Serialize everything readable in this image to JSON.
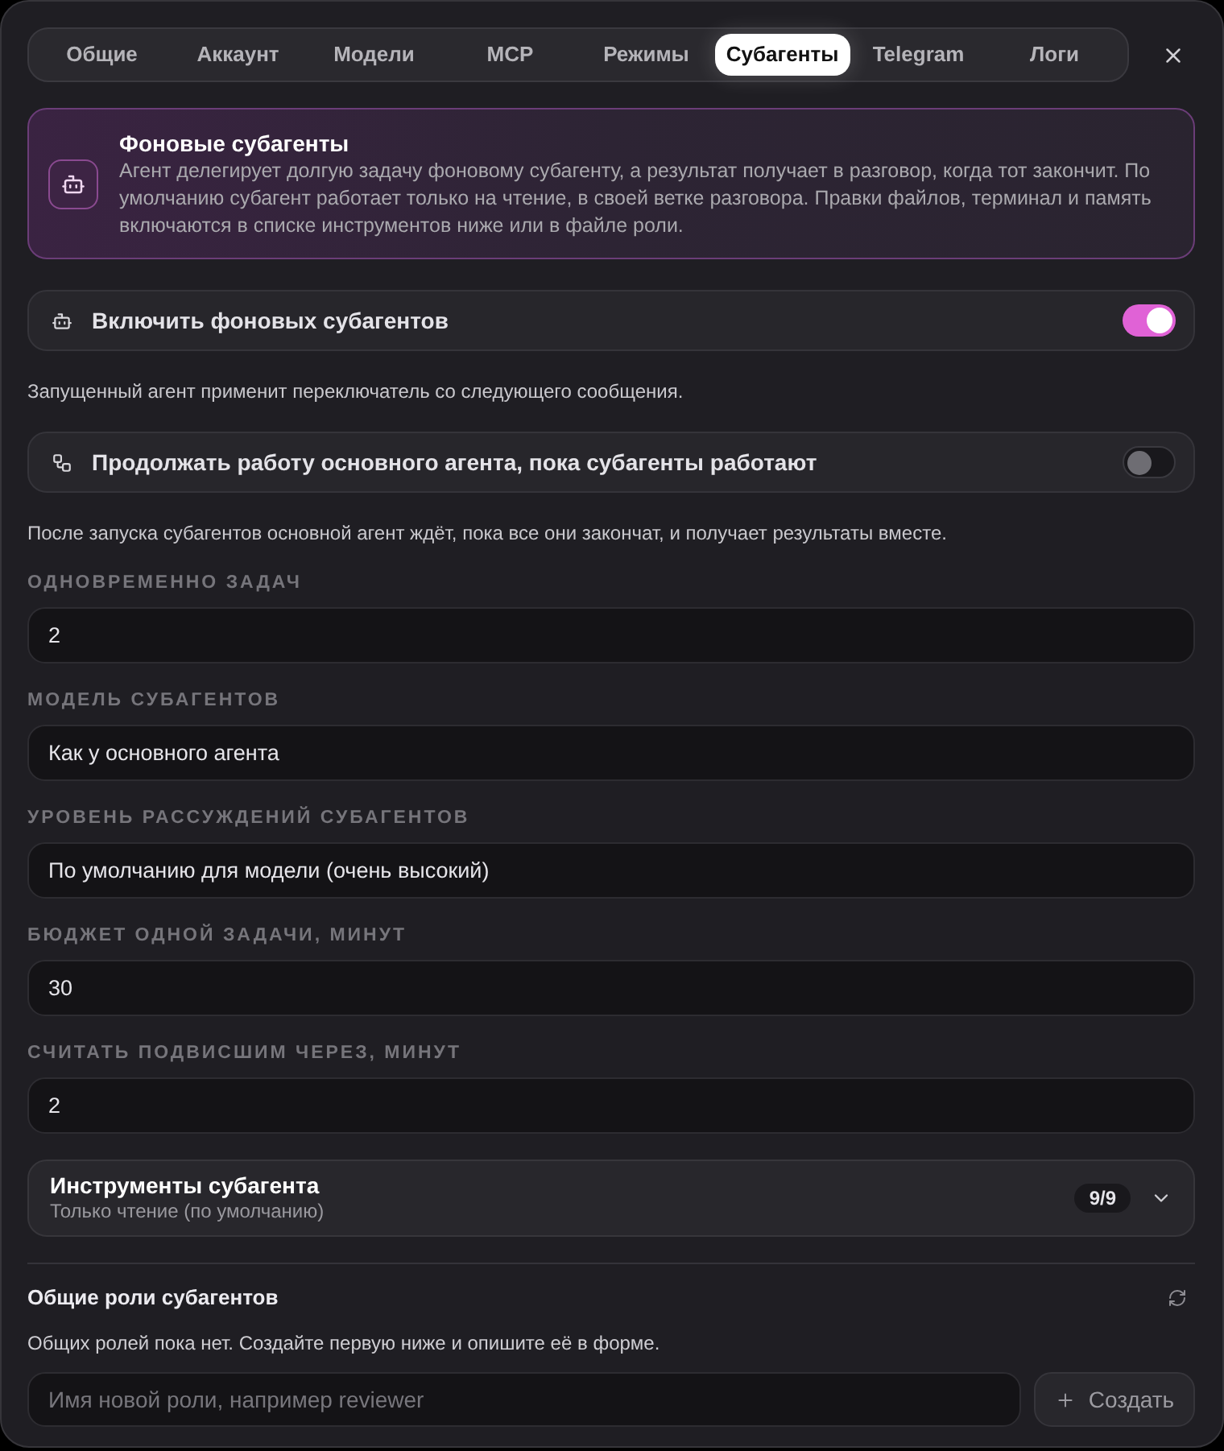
{
  "tabs": [
    {
      "label": "Общие",
      "selected": false
    },
    {
      "label": "Аккаунт",
      "selected": false
    },
    {
      "label": "Модели",
      "selected": false
    },
    {
      "label": "MCP",
      "selected": false
    },
    {
      "label": "Режимы",
      "selected": false
    },
    {
      "label": "Субагенты",
      "selected": true
    },
    {
      "label": "Telegram",
      "selected": false
    },
    {
      "label": "Логи",
      "selected": false
    }
  ],
  "info_card": {
    "title": "Фоновые субагенты",
    "text": "Агент делегирует долгую задачу фоновому субагенту, а результат получает в разговор, когда тот закончит. По умолчанию субагент работает только на чтение, в своей ветке разговора. Правки файлов, терминал и память включаются в списке инструментов ниже или в файле роли."
  },
  "toggles": [
    {
      "label": "Включить фоновых субагентов",
      "on": true,
      "note": "Запущенный агент применит переключатель со следующего сообщения."
    },
    {
      "label": "Продолжать работу основного агента, пока субагенты работают",
      "on": false,
      "note": "После запуска субагентов основной агент ждёт, пока все они закончат, и получает результаты вместе."
    }
  ],
  "fields": [
    {
      "label": "ОДНОВРЕМЕННО ЗАДАЧ",
      "value": "2"
    },
    {
      "label": "МОДЕЛЬ СУБАГЕНТОВ",
      "value": "Как у основного агента"
    },
    {
      "label": "УРОВЕНЬ РАССУЖДЕНИЙ СУБАГЕНТОВ",
      "value": "По умолчанию для модели (очень высокий)"
    },
    {
      "label": "БЮДЖЕТ ОДНОЙ ЗАДАЧИ, МИНУТ",
      "value": "30"
    },
    {
      "label": "СЧИТАТЬ ПОДВИСШИМ ЧЕРЕЗ, МИНУТ",
      "value": "2"
    }
  ],
  "tools": {
    "title": "Инструменты субагента",
    "subtitle": "Только чтение (по умолчанию)",
    "count": "9/9",
    "expanded": false
  },
  "roles": {
    "title": "Общие роли субагентов",
    "empty_text": "Общих ролей пока нет. Создайте первую ниже и опишите её в форме.",
    "new_role": {
      "placeholder": "Имя новой роли, например reviewer"
    },
    "create_button": {
      "label": "Создать",
      "disabled": true
    }
  }
}
